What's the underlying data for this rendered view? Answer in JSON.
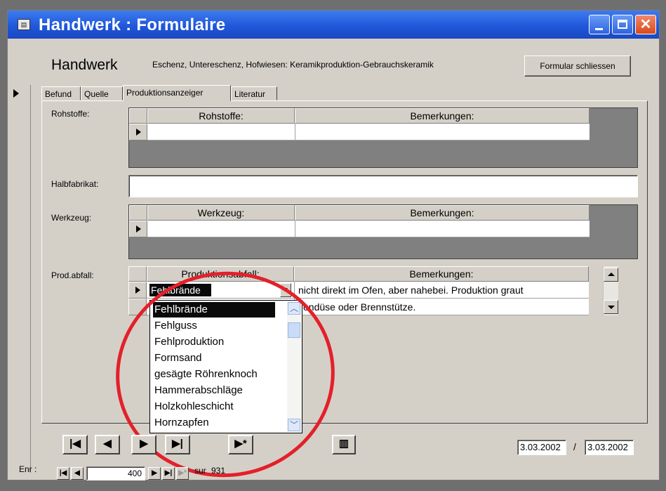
{
  "window": {
    "title": "Handwerk : Formulaire"
  },
  "header": {
    "title": "Handwerk",
    "subtitle": "Eschenz, Untereschenz, Hofwiesen: Keramikproduktion-Gebrauchskeramik",
    "close_form_label": "Formular schliessen"
  },
  "tabs": [
    {
      "label": "Befund"
    },
    {
      "label": "Quelle"
    },
    {
      "label": "Produktionsanzeiger"
    },
    {
      "label": "Literatur"
    }
  ],
  "fields": {
    "rohstoffe_label": "Rohstoffe:",
    "halbfabrikat_label": "Halbfabrikat:",
    "werkzeug_label": "Werkzeug:",
    "prodabfall_label": "Prod.abfall:"
  },
  "rohstoffe_table": {
    "col1": "Rohstoffe:",
    "col2": "Bemerkungen:"
  },
  "werkzeug_table": {
    "col1": "Werkzeug:",
    "col2": "Bemerkungen:"
  },
  "prodabfall_table": {
    "col1": "Produktionsabfall:",
    "col2": "Bemerkungen:",
    "rows": [
      {
        "abfall": "Fehlbrände",
        "bemerkung": "nicht direkt im Ofen, aber nahebei. Produktion graut"
      },
      {
        "abfall": "",
        "bemerkung": "Tondüse oder Brennstütze."
      }
    ]
  },
  "dropdown": {
    "items": [
      "Fehlbrände",
      "Fehlguss",
      "Fehlproduktion",
      "Formsand",
      "gesägte Röhrenknoch",
      "Hammerabschläge",
      "Holzkohleschicht",
      "Hornzapfen"
    ],
    "selected_index": 0
  },
  "dates": {
    "created": "3.03.2002",
    "separator": "/",
    "modified": "3.03.2002"
  },
  "record_nav": {
    "label": "Enr :",
    "current": "400",
    "of_label": "sur",
    "total": "931"
  },
  "icons": {
    "title": "form-icon",
    "delete": "delete-record-icon"
  },
  "colors": {
    "title_bar": "#2358da",
    "annotation_circle": "#e4202a",
    "selection": "#0a0a0a"
  }
}
